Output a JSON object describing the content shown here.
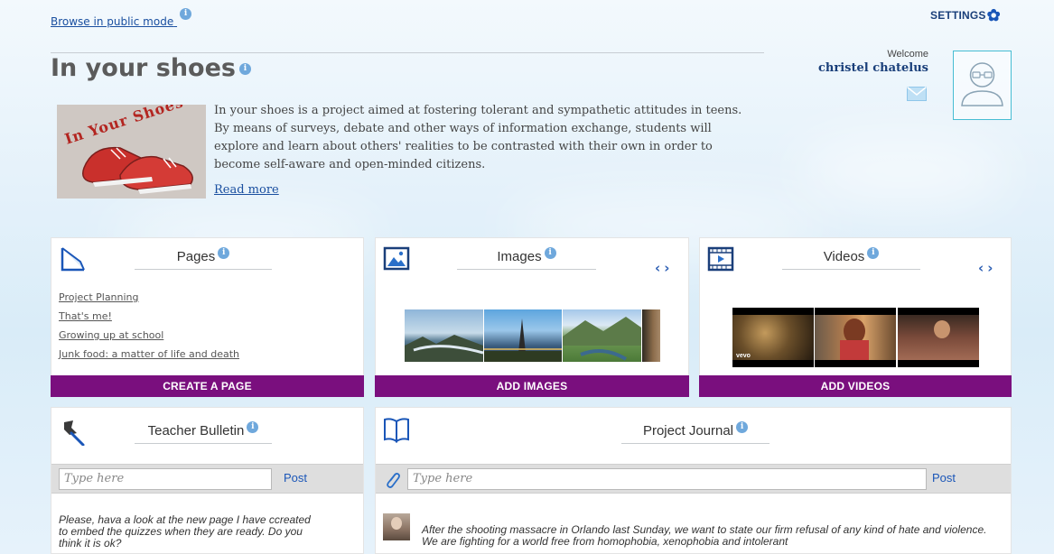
{
  "header": {
    "browse_public": "Browse in public mode",
    "settings": "SETTINGS",
    "welcome": "Welcome",
    "user_name": "christel chatelus"
  },
  "project": {
    "title": "In your shoes",
    "description": "In your shoes is a project aimed at fostering tolerant and sympathetic attitudes in teens. By means of surveys, debate and other ways of information exchange, students will explore and learn about others' realities to be contrasted with their own in order to become self-aware and open-minded citizens.",
    "read_more": "Read more",
    "thumb_text": "In Your Shoes"
  },
  "pages_card": {
    "title": "Pages",
    "links": [
      "Project Planning",
      "That's me!",
      "Growing up at school",
      "Junk food: a matter of life and death"
    ],
    "button": "CREATE A PAGE"
  },
  "images_card": {
    "title": "Images",
    "button": "ADD IMAGES"
  },
  "videos_card": {
    "title": "Videos",
    "button": "ADD VIDEOS",
    "vevo_label": "vevo"
  },
  "bulletin_card": {
    "title": "Teacher Bulletin",
    "input_placeholder": "Type here",
    "post": "Post",
    "message": "Please, hava a look at the new page I have ccreated to embed the quizzes when they are ready. Do you think it is ok?"
  },
  "journal_card": {
    "title": "Project Journal",
    "input_placeholder": "Type here",
    "post": "Post",
    "message": "After the shooting massacre in Orlando last Sunday, we want to state our firm refusal of any kind of hate and violence. We are fighting for a world free from homophobia, xenophobia and intolerant"
  },
  "icons": {
    "info": "info-icon",
    "settings": "gear-icon",
    "mail": "envelope-icon",
    "avatar": "user-avatar-icon",
    "pages": "page-icon",
    "images": "image-icon",
    "videos": "film-icon",
    "bulletin": "pushpin-icon",
    "journal": "book-icon",
    "attach": "paperclip-icon",
    "prev": "chevron-left-icon",
    "next": "chevron-right-icon"
  },
  "colors": {
    "accent_purple": "#7a0f7e",
    "link_blue": "#1a4fa0",
    "info_blue": "#6fa8dc",
    "avatar_border": "#47bdd3"
  }
}
